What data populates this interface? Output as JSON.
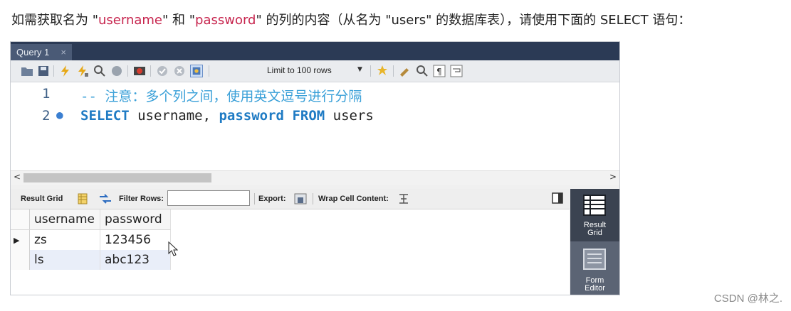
{
  "intro": {
    "part1": "如需获取名为 \"",
    "username": "username",
    "part2": "\" 和 \"",
    "password": "password",
    "part3": "\" 的列的内容（从名为 \"users\" 的数据库表），请使用下面的 SELECT 语句："
  },
  "tab": {
    "title": "Query 1",
    "close": "×"
  },
  "toolbar": {
    "limit_label": "Limit to 100 rows",
    "icons": [
      "open-folder-icon",
      "save-icon",
      "execute-icon",
      "execute-current-icon",
      "explain-icon",
      "stop-icon",
      "toggle-error-icon",
      "commit-icon",
      "rollback-icon",
      "autocommit-icon",
      "limit-dropdown",
      "beautify-icon",
      "find-icon",
      "invisible-chars-icon",
      "wrap-icon"
    ]
  },
  "editor": {
    "line1": {
      "num": "1",
      "text": "-- 注意：多个列之间，使用英文逗号进行分隔"
    },
    "line2": {
      "num": "2",
      "kw_select": "SELECT",
      "cols": " username, ",
      "kw_password": "password",
      "kw_from": "FROM",
      "table": " users"
    }
  },
  "scroll": {
    "left": "<",
    "right": ">"
  },
  "results_toolbar": {
    "result_grid": "Result Grid",
    "filter_rows": "Filter Rows:",
    "export": "Export:",
    "wrap": "Wrap Cell Content:"
  },
  "grid": {
    "columns": [
      "username",
      "password"
    ],
    "rows": [
      [
        "zs",
        "123456"
      ],
      [
        "ls",
        "abc123"
      ]
    ]
  },
  "side_panel": {
    "result_grid_l1": "Result",
    "result_grid_l2": "Grid",
    "form_editor_l1": "Form",
    "form_editor_l2": "Editor"
  },
  "watermark": "CSDN @林之."
}
